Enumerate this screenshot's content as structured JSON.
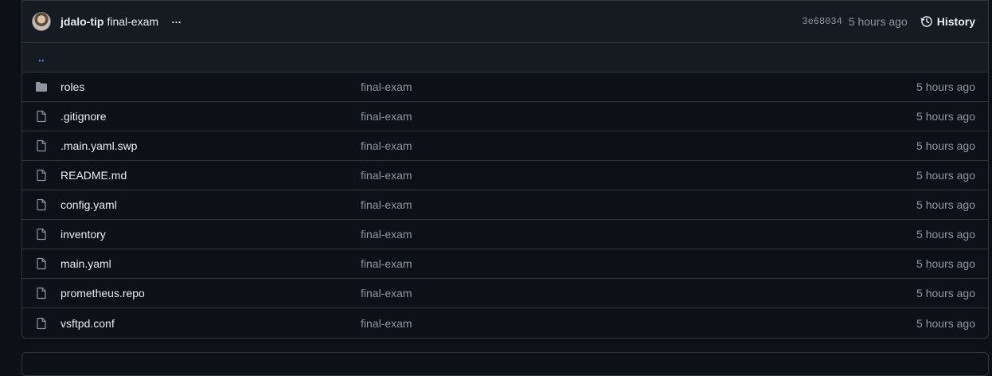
{
  "commit": {
    "author": "jdalo-tip",
    "message": "final-exam",
    "more": "…",
    "sha": "3e68034",
    "time": "5 hours ago",
    "history_label": "History"
  },
  "parent_link": "..",
  "files": [
    {
      "name": "roles",
      "type": "folder",
      "message": "final-exam",
      "age": "5 hours ago"
    },
    {
      "name": ".gitignore",
      "type": "file",
      "message": "final-exam",
      "age": "5 hours ago"
    },
    {
      "name": ".main.yaml.swp",
      "type": "file",
      "message": "final-exam",
      "age": "5 hours ago"
    },
    {
      "name": "README.md",
      "type": "file",
      "message": "final-exam",
      "age": "5 hours ago"
    },
    {
      "name": "config.yaml",
      "type": "file",
      "message": "final-exam",
      "age": "5 hours ago"
    },
    {
      "name": "inventory",
      "type": "file",
      "message": "final-exam",
      "age": "5 hours ago"
    },
    {
      "name": "main.yaml",
      "type": "file",
      "message": "final-exam",
      "age": "5 hours ago"
    },
    {
      "name": "prometheus.repo",
      "type": "file",
      "message": "final-exam",
      "age": "5 hours ago"
    },
    {
      "name": "vsftpd.conf",
      "type": "file",
      "message": "final-exam",
      "age": "5 hours ago"
    }
  ],
  "colors": {
    "background": "#0d1117",
    "header": "#161b22",
    "border": "#30363d",
    "link": "#4493f8",
    "muted": "#8d96a0",
    "text": "#e6edf3"
  }
}
